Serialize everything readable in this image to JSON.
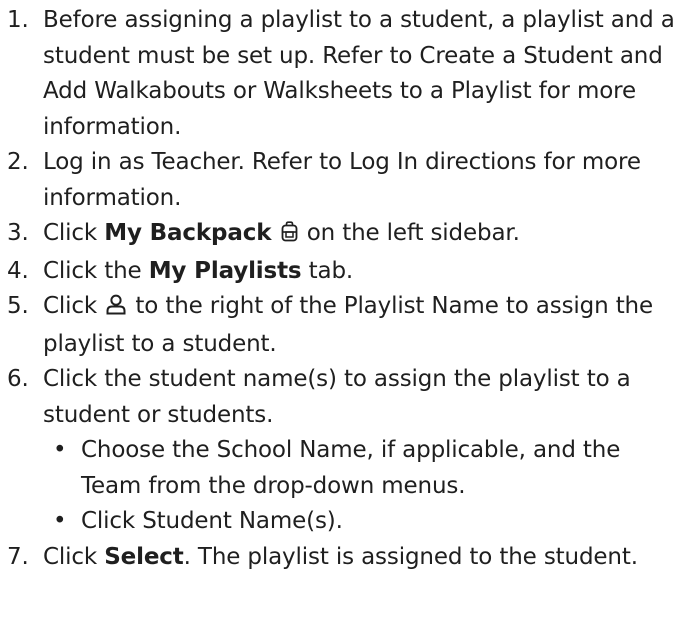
{
  "steps": [
    {
      "num": "1.",
      "text": "Before assigning a playlist to a student, a playlist and a student must be set up. Refer to Create a Student and Add Walkabouts or Walksheets to a Playlist for more information."
    },
    {
      "num": "2.",
      "text": "Log in as Teacher. Refer to Log In directions for more information."
    },
    {
      "num": "3.",
      "pre": "Click ",
      "bold": "My Backpack",
      "post": " on the left sidebar.",
      "icon": "backpack-icon"
    },
    {
      "num": "4.",
      "pre": "Click the ",
      "bold": "My Playlists",
      "post": " tab."
    },
    {
      "num": "5.",
      "pre": "Click ",
      "post": " to the right of the Playlist Name to assign the playlist to a student.",
      "icon": "person-icon"
    },
    {
      "num": "6.",
      "text": "Click the student name(s) to assign the playlist to a student or students.",
      "subs": [
        "Choose the School Name, if applicable, and the Team from the drop-down menus.",
        "Click Student Name(s)."
      ]
    },
    {
      "num": "7.",
      "pre": "Click ",
      "bold": "Select",
      "post": ". The playlist is assigned to the student."
    }
  ],
  "bullet": "•",
  "colors": {
    "heading": "#1a88c4",
    "text": "#1f1f1f"
  }
}
